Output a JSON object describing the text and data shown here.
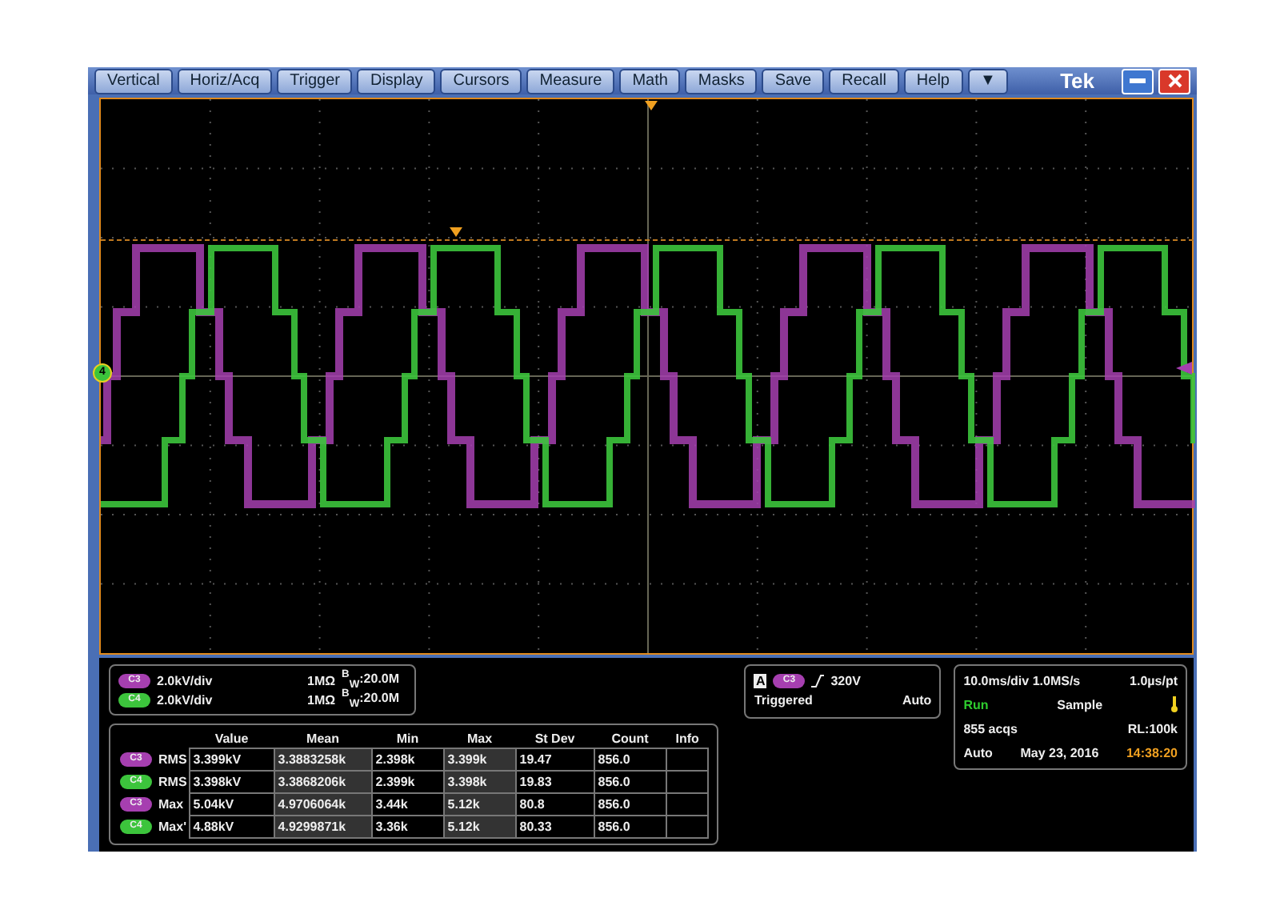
{
  "menu": {
    "items": [
      "Vertical",
      "Horiz/Acq",
      "Trigger",
      "Display",
      "Cursors",
      "Measure",
      "Math",
      "Masks",
      "Save",
      "Recall",
      "Help"
    ],
    "dropdown": "▼",
    "brand": "Tek"
  },
  "display": {
    "ground_marker": "4"
  },
  "channels": [
    {
      "badge": "C3",
      "color": "#a63fb0",
      "scale": "2.0kV/div",
      "impedance": "1MΩ",
      "bandwidth": "$^{B}$$_{W}$:20.0M"
    },
    {
      "badge": "C4",
      "color": "#3cc43c",
      "scale": "2.0kV/div",
      "impedance": "1MΩ",
      "bandwidth": "$^{B}$$_{W}$:20.0M"
    }
  ],
  "measurements": {
    "columns": [
      "Value",
      "Mean",
      "Min",
      "Max",
      "St Dev",
      "Count",
      "Info"
    ],
    "rows": [
      {
        "badge": "C3",
        "color": "#a63fb0",
        "label": "RMS",
        "cells": [
          "3.399kV",
          "3.3883258k",
          "2.398k",
          "3.399k",
          "19.47",
          "856.0",
          ""
        ]
      },
      {
        "badge": "C4",
        "color": "#3cc43c",
        "label": "RMS",
        "cells": [
          "3.398kV",
          "3.3868206k",
          "2.399k",
          "3.398k",
          "19.83",
          "856.0",
          ""
        ]
      },
      {
        "badge": "C3",
        "color": "#a63fb0",
        "label": "Max",
        "cells": [
          "5.04kV",
          "4.9706064k",
          "3.44k",
          "5.12k",
          "80.8",
          "856.0",
          ""
        ]
      },
      {
        "badge": "C4",
        "color": "#3cc43c",
        "label": "Max'",
        "cells": [
          "4.88kV",
          "4.9299871k",
          "3.36k",
          "5.12k",
          "80.33",
          "856.0",
          ""
        ]
      }
    ]
  },
  "trigger": {
    "type": "A",
    "badge": "C3",
    "color": "#a63fb0",
    "level": "320V",
    "status": "Triggered",
    "mode": "Auto"
  },
  "acquisition": {
    "timebase": "10.0ms/div 1.0MS/s",
    "resolution": "1.0µs/pt",
    "state": "Run",
    "mode": "Sample",
    "count": "855 acqs",
    "record_length": "RL:100k",
    "run_mode": "Auto",
    "date": "May 23, 2016",
    "time": "14:38:20"
  }
}
